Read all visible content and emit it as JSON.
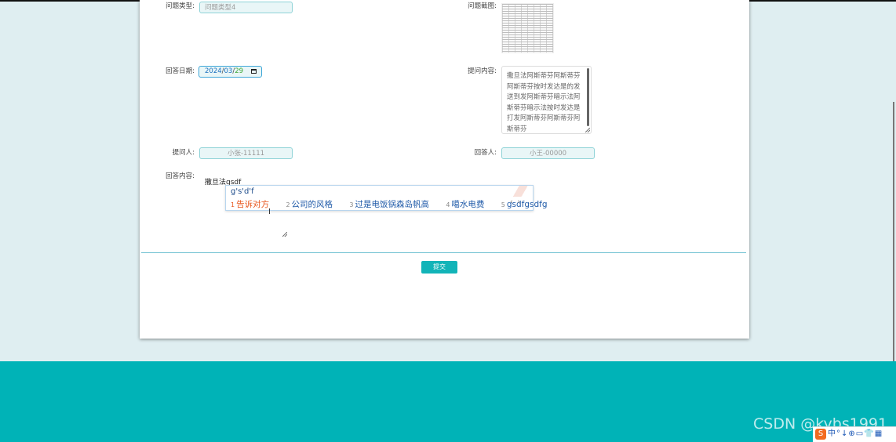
{
  "form": {
    "question_type_label": "问题类型:",
    "question_type_value": "问题类型4",
    "question_image_label": "问题截图:",
    "answer_date_label": "回答日期:",
    "answer_date": {
      "year": "2024",
      "month": "03",
      "day": "29"
    },
    "question_content_label": "提问内容:",
    "question_content": "撒旦法阿斯蒂芬阿斯蒂芬阿斯蒂芬按时发达是的发送到发阿斯蒂芬暗示法阿斯蒂芬暗示法按时发达是打发阿斯蒂芬阿斯蒂芬阿斯蒂芬",
    "asker_label": "提问人:",
    "asker_value": "小张-11111",
    "answerer_label": "回答人:",
    "answerer_value": "小王-00000",
    "answer_content_label": "回答内容:",
    "answer_content_value": "撒旦法gsdf",
    "submit_label": "提交"
  },
  "ime": {
    "pinyin": "g's'd'f",
    "candidates": [
      {
        "num": "1",
        "text": "告诉对方"
      },
      {
        "num": "2",
        "text": "公司的风格"
      },
      {
        "num": "3",
        "text": "过是电饭锅森岛帆高"
      },
      {
        "num": "4",
        "text": "噶水电费"
      },
      {
        "num": "5",
        "text": "gsdfgsdfg"
      }
    ],
    "prev": "‹",
    "next": "›"
  },
  "watermark": "CSDN @kybs1991",
  "tray": {
    "logo": "S",
    "icons": [
      "中",
      "°",
      "↓",
      "⊕",
      "▭",
      "👕",
      "▦"
    ]
  },
  "colors": {
    "accent": "#00b3b7",
    "button": "#12b4b8",
    "ime_highlight": "#e8561c"
  }
}
